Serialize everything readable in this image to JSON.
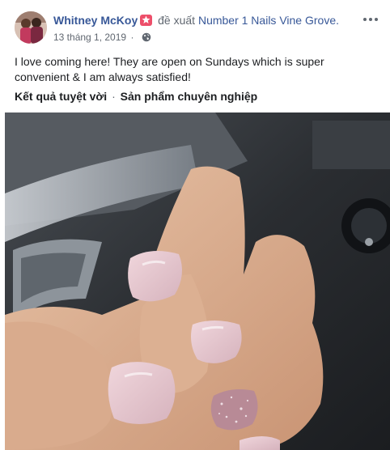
{
  "post": {
    "author": "Whitney McKoy",
    "action": "đề xuất",
    "page": "Number 1 Nails Vine Grove.",
    "date": "13 tháng 1, 2019",
    "text": "I love coming here! They are open on Sundays which is super convenient & I am always satisfied!",
    "tags": [
      "Kết quả tuyệt vời",
      "Sản phẩm chuyên nghiệp"
    ],
    "tag_separator": "·",
    "menu_icon": "more-horizontal-icon",
    "privacy_icon": "globe-icon",
    "badge_icon": "recommendation-badge-icon"
  },
  "colors": {
    "link": "#385898",
    "meta": "#606770",
    "badge": "#ed4f6a",
    "nail_polish": "#e3c4cc"
  }
}
